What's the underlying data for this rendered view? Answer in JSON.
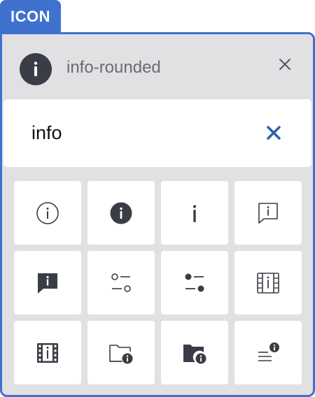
{
  "tab": {
    "label": "ICON"
  },
  "header": {
    "title": "info-rounded",
    "icon": "info-filled-icon",
    "close_icon": "close-icon"
  },
  "search": {
    "value": "info",
    "placeholder": "",
    "clear_icon": "clear-x-icon"
  },
  "grid": {
    "icons": [
      "info-outline-icon",
      "info-filled-icon",
      "info-i-icon",
      "info-chat-outline-icon",
      "info-chat-filled-icon",
      "toggle-options-outline-icon",
      "toggle-options-filled-icon",
      "film-info-outline-icon",
      "film-info-filled-icon",
      "folder-info-outline-icon",
      "folder-info-filled-icon",
      "list-info-icon"
    ]
  },
  "colors": {
    "accent": "#3f72cf",
    "panel_bg": "#e1e1e4",
    "icon_dark": "#3b3d46",
    "clear_x": "#2f5fb0"
  }
}
